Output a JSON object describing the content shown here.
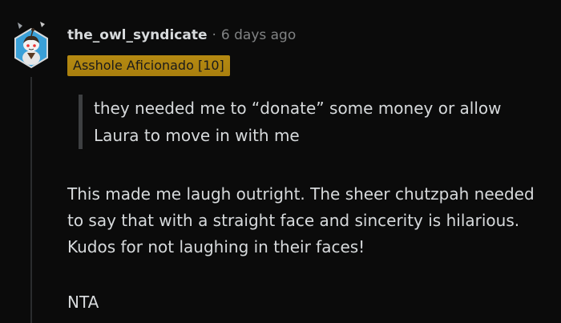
{
  "comment": {
    "username": "the_owl_syndicate",
    "separator": "·",
    "timestamp": "6 days ago",
    "flair": "Asshole Aficionado [10]",
    "quote": "they needed me to “donate” some money or allow Laura to move in with me",
    "body": "This made me laugh outright. The sheer chutzpah needed to say that with a straight face and sincerity is hilarious. Kudos for not laughing in their faces!",
    "verdict": "NTA"
  },
  "colors": {
    "background": "#0b0b0b",
    "text": "#d7dadc",
    "muted": "#818384",
    "flair_bg": "#b58a12",
    "quote_bar": "#3e4042"
  },
  "icons": {
    "avatar": "snoo-avatar-icon"
  }
}
